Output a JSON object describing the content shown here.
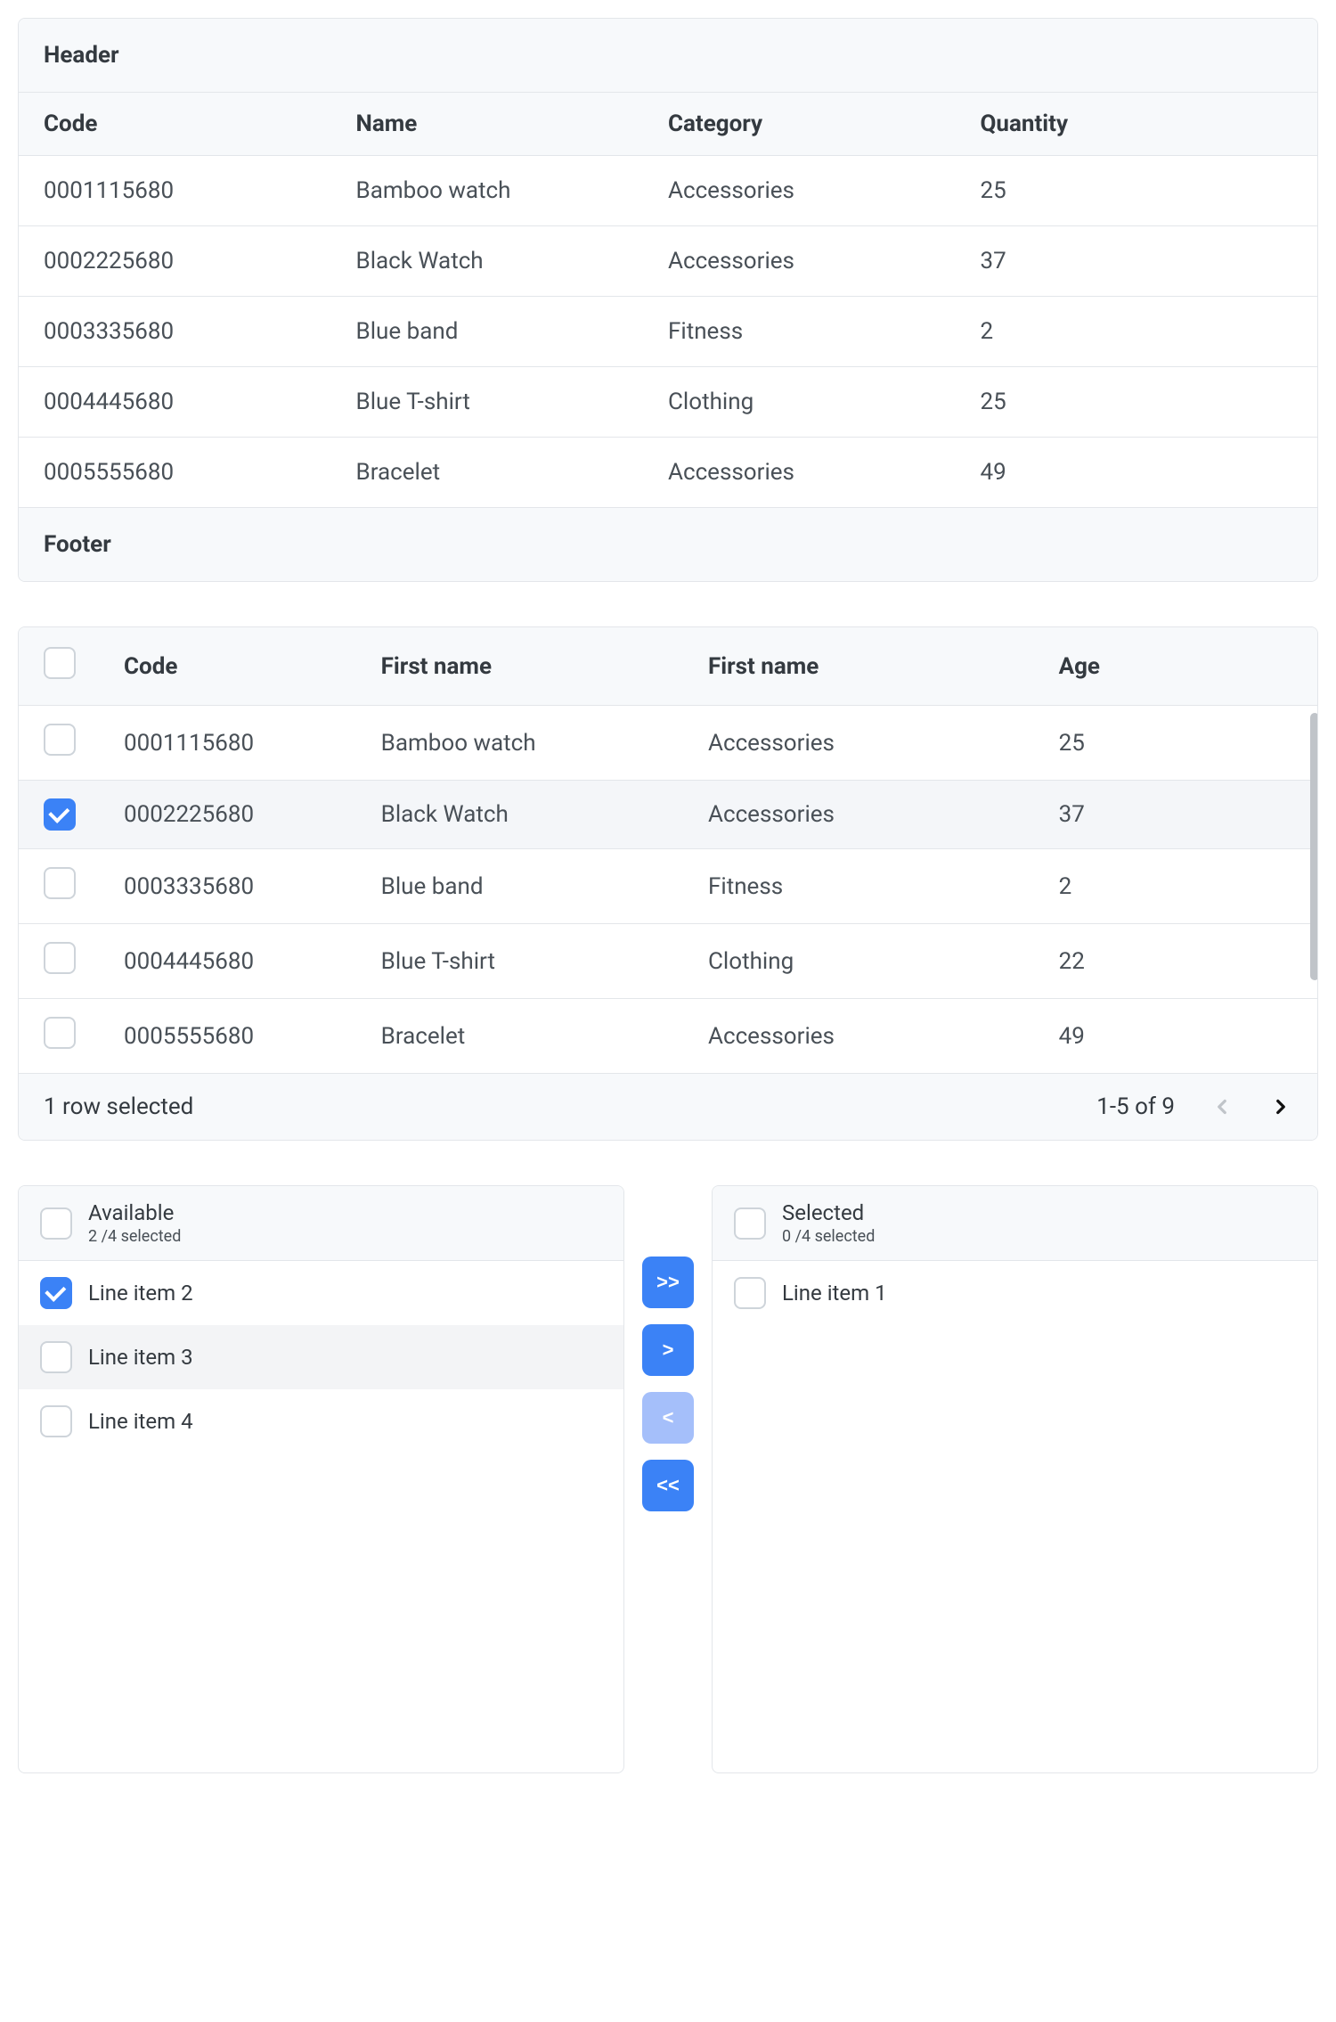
{
  "table1": {
    "header": "Header",
    "footer": "Footer",
    "columns": [
      "Code",
      "Name",
      "Category",
      "Quantity"
    ],
    "rows": [
      {
        "code": "0001115680",
        "name": "Bamboo watch",
        "category": "Accessories",
        "qty": "25"
      },
      {
        "code": "0002225680",
        "name": "Black Watch",
        "category": "Accessories",
        "qty": "37"
      },
      {
        "code": "0003335680",
        "name": "Blue band",
        "category": "Fitness",
        "qty": "2"
      },
      {
        "code": "0004445680",
        "name": "Blue T-shirt",
        "category": "Clothing",
        "qty": "25"
      },
      {
        "code": "0005555680",
        "name": "Bracelet",
        "category": "Accessories",
        "qty": "49"
      }
    ]
  },
  "table2": {
    "columns": [
      "Code",
      "First name",
      "First name",
      "Age"
    ],
    "rows": [
      {
        "code": "0001115680",
        "c2": "Bamboo watch",
        "c3": "Accessories",
        "c4": "25",
        "checked": false
      },
      {
        "code": "0002225680",
        "c2": "Black Watch",
        "c3": "Accessories",
        "c4": "37",
        "checked": true
      },
      {
        "code": "0003335680",
        "c2": "Blue band",
        "c3": "Fitness",
        "c4": "2",
        "checked": false
      },
      {
        "code": "0004445680",
        "c2": "Blue T-shirt",
        "c3": "Clothing",
        "c4": "22",
        "checked": false
      },
      {
        "code": "0005555680",
        "c2": "Bracelet",
        "c3": "Accessories",
        "c4": "49",
        "checked": false
      }
    ],
    "selection": "1 row selected",
    "range": "1-5 of 9"
  },
  "transfer": {
    "buttons": {
      "all_right": ">>",
      "right": ">",
      "left": "<",
      "all_left": "<<"
    },
    "available": {
      "title": "Available",
      "sub": "2 /4 selected",
      "items": [
        {
          "label": "Line item 2",
          "checked": true,
          "hover": false
        },
        {
          "label": "Line item 3",
          "checked": false,
          "hover": true
        },
        {
          "label": "Line item 4",
          "checked": false,
          "hover": false
        }
      ]
    },
    "selected": {
      "title": "Selected",
      "sub": "0 /4 selected",
      "items": [
        {
          "label": "Line item 1",
          "checked": false,
          "hover": false
        }
      ]
    }
  }
}
